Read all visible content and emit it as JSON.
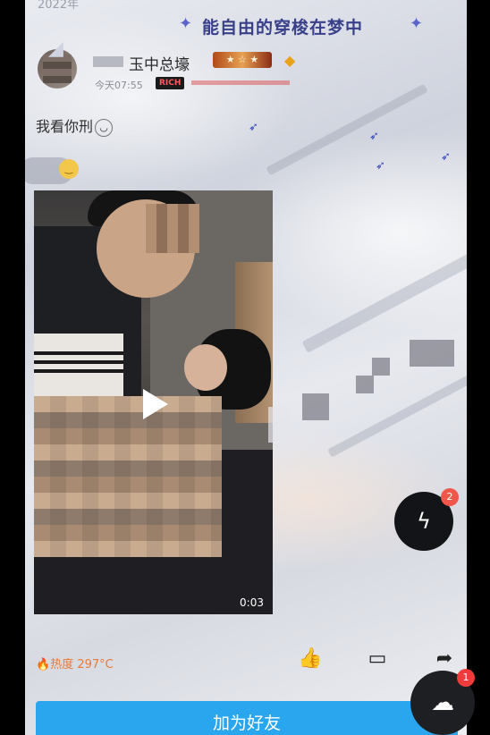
{
  "header": {
    "date_fragment": "2022年",
    "banner": "能自由的穿梭在梦中"
  },
  "post": {
    "author": {
      "name": "玉中总壕",
      "time": "今天07:55",
      "rich_tag": "RICH"
    },
    "text": "我看你刑",
    "video": {
      "duration": "0:03"
    },
    "heat": "热度 297°C"
  },
  "actions": {
    "add_friend": "加为好友"
  },
  "badges": {
    "chat_count": "2",
    "upload_count": "1"
  },
  "icons": [
    "play-icon",
    "like-icon",
    "comment-icon",
    "share-icon",
    "lightning-chat-icon",
    "upload-cloud-icon",
    "fire-icon"
  ]
}
